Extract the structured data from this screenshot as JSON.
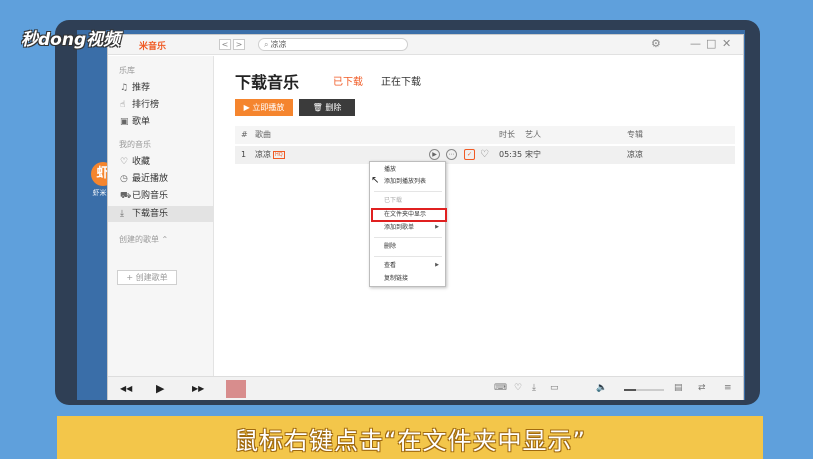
{
  "overlay": {
    "brand_logo": "秒dong视频",
    "caption": "鼠标右键点击“在文件夹中显示”"
  },
  "desktop": {
    "icon_label": "虾米音"
  },
  "app": {
    "logo_text": "米音乐",
    "search": {
      "value": "凉凉"
    },
    "window_controls": {
      "settings": "⚙",
      "minimize": "—",
      "maximize": "□",
      "close": "✕"
    }
  },
  "sidebar": {
    "library_title": "乐库",
    "library_items": [
      {
        "label": "推荐",
        "icon": "music-note-icon"
      },
      {
        "label": "排行榜",
        "icon": "hand-icon"
      },
      {
        "label": "歌单",
        "icon": "screen-icon"
      }
    ],
    "my_music_title": "我的音乐",
    "my_music_items": [
      {
        "label": "收藏",
        "icon": "heart-icon"
      },
      {
        "label": "最近播放",
        "icon": "clock-icon"
      },
      {
        "label": "已购音乐",
        "icon": "cart-icon"
      },
      {
        "label": "下载音乐",
        "icon": "download-icon",
        "active": true
      }
    ],
    "playlist_title": "创建的歌单",
    "create_button": "+ 创建歌单"
  },
  "main": {
    "title": "下载音乐",
    "tabs": [
      {
        "label": "已下载",
        "active": true
      },
      {
        "label": "正在下载",
        "active": false
      }
    ],
    "play_button": "立即播放",
    "delete_button": "删除",
    "columns": {
      "index": "#",
      "song": "歌曲",
      "duration": "时长",
      "artist": "艺人",
      "album": "专辑"
    },
    "rows": [
      {
        "index": "1",
        "song": "凉凉",
        "quality": "HQ",
        "duration": "05:35",
        "artist": "宋宁",
        "album": "凉凉"
      }
    ]
  },
  "context_menu": {
    "items": [
      {
        "label": "播放",
        "disabled": false
      },
      {
        "label": "添加到播放列表",
        "disabled": false
      },
      {
        "label": "已下载",
        "disabled": true
      },
      {
        "label": "在文件夹中显示",
        "disabled": false,
        "highlighted": true
      },
      {
        "label": "添加到歌单",
        "disabled": false,
        "submenu": true
      },
      {
        "label": "删除",
        "disabled": false
      },
      {
        "label": "查看",
        "disabled": false,
        "submenu": true
      },
      {
        "label": "复制链接",
        "disabled": false
      }
    ]
  },
  "player": {
    "prev": "◀◀",
    "play": "▶",
    "next": "▶▶"
  },
  "colors": {
    "accent": "#f05a24",
    "play_button": "#f5852e",
    "highlight_border": "#e02020",
    "caption_bar": "#f3c64a",
    "background": "#5fa0dc"
  }
}
